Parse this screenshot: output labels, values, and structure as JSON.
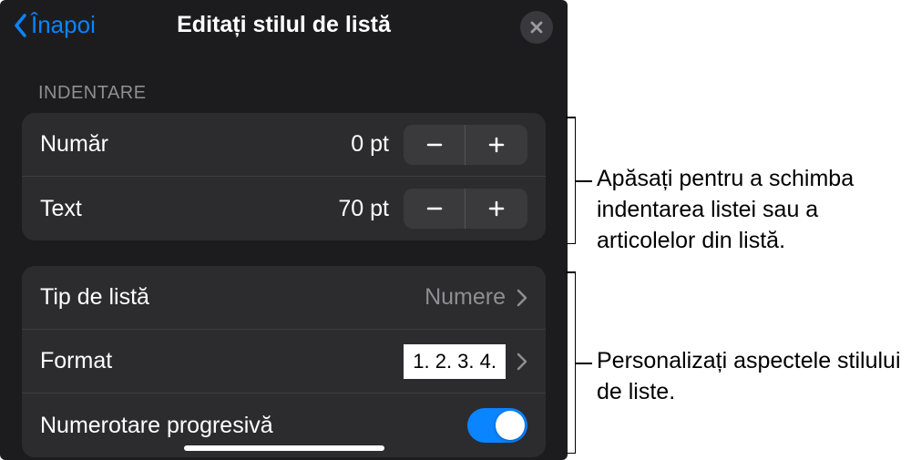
{
  "header": {
    "back_label": "Înapoi",
    "title": "Editați stilul de listă"
  },
  "sections": {
    "indent_label": "INDENTARE"
  },
  "indent": {
    "number_label": "Număr",
    "number_value": "0 pt",
    "text_label": "Text",
    "text_value": "70 pt"
  },
  "list_style": {
    "type_label": "Tip de listă",
    "type_value": "Numere",
    "format_label": "Format",
    "format_preview": "1. 2. 3. 4.",
    "progressive_label": "Numerotare progresivă",
    "progressive_on": true
  },
  "annotations": {
    "callout1": "Apăsați pentru a schimba indentarea listei sau a articolelor din listă.",
    "callout2": "Personalizați aspectele stilului de liste."
  }
}
